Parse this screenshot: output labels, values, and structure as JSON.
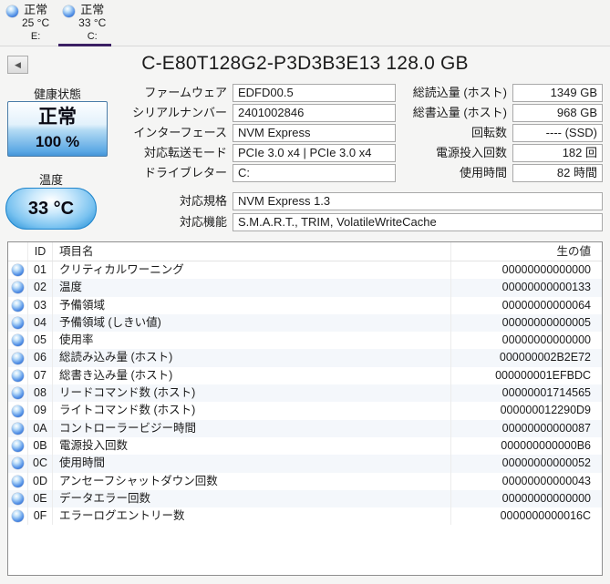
{
  "tabs": [
    {
      "status": "正常",
      "temp": "25 °C",
      "drive": "E:",
      "selected": false
    },
    {
      "status": "正常",
      "temp": "33 °C",
      "drive": "C:",
      "selected": true
    }
  ],
  "header": {
    "title": "C-E80T128G2-P3D3B3E13 128.0 GB"
  },
  "health": {
    "label": "健康状態",
    "status": "正常",
    "percent": "100 %"
  },
  "temperature": {
    "label": "温度",
    "value": "33 °C"
  },
  "info_left": [
    {
      "label": "ファームウェア",
      "value": "EDFD00.5"
    },
    {
      "label": "シリアルナンバー",
      "value": "2401002846"
    },
    {
      "label": "インターフェース",
      "value": "NVM Express"
    },
    {
      "label": "対応転送モード",
      "value": "PCIe 3.0 x4 | PCIe 3.0 x4"
    },
    {
      "label": "ドライブレター",
      "value": "C:"
    }
  ],
  "info_wide": [
    {
      "label": "対応規格",
      "value": "NVM Express 1.3"
    },
    {
      "label": "対応機能",
      "value": "S.M.A.R.T., TRIM, VolatileWriteCache"
    }
  ],
  "info_right": [
    {
      "label": "総読込量 (ホスト)",
      "value": "1349 GB"
    },
    {
      "label": "総書込量 (ホスト)",
      "value": "968 GB"
    },
    {
      "label": "回転数",
      "value": "---- (SSD)"
    },
    {
      "label": "電源投入回数",
      "value": "182 回"
    },
    {
      "label": "使用時間",
      "value": "82 時間"
    }
  ],
  "smart_table": {
    "headers": {
      "id": "ID",
      "name": "項目名",
      "raw": "生の値"
    },
    "rows": [
      {
        "id": "01",
        "name": "クリティカルワーニング",
        "raw": "00000000000000"
      },
      {
        "id": "02",
        "name": "温度",
        "raw": "00000000000133"
      },
      {
        "id": "03",
        "name": "予備領域",
        "raw": "00000000000064"
      },
      {
        "id": "04",
        "name": "予備領域 (しきい値)",
        "raw": "00000000000005"
      },
      {
        "id": "05",
        "name": "使用率",
        "raw": "00000000000000"
      },
      {
        "id": "06",
        "name": "総読み込み量 (ホスト)",
        "raw": "000000002B2E72"
      },
      {
        "id": "07",
        "name": "総書き込み量 (ホスト)",
        "raw": "000000001EFBDC"
      },
      {
        "id": "08",
        "name": "リードコマンド数 (ホスト)",
        "raw": "00000001714565"
      },
      {
        "id": "09",
        "name": "ライトコマンド数 (ホスト)",
        "raw": "000000012290D9"
      },
      {
        "id": "0A",
        "name": "コントローラービジー時間",
        "raw": "00000000000087"
      },
      {
        "id": "0B",
        "name": "電源投入回数",
        "raw": "000000000000B6"
      },
      {
        "id": "0C",
        "name": "使用時間",
        "raw": "00000000000052"
      },
      {
        "id": "0D",
        "name": "アンセーフシャットダウン回数",
        "raw": "00000000000043"
      },
      {
        "id": "0E",
        "name": "データエラー回数",
        "raw": "00000000000000"
      },
      {
        "id": "0F",
        "name": "エラーログエントリー数",
        "raw": "0000000000016C"
      }
    ]
  },
  "colors": {
    "selected_tab_underline": "#3b2064",
    "health_button_blue": "#5aa7e4",
    "temperature_pill_blue": "#1d8ad4",
    "status_orb_blue": "#2a62c8",
    "alt_row": "#f4f7fb"
  }
}
